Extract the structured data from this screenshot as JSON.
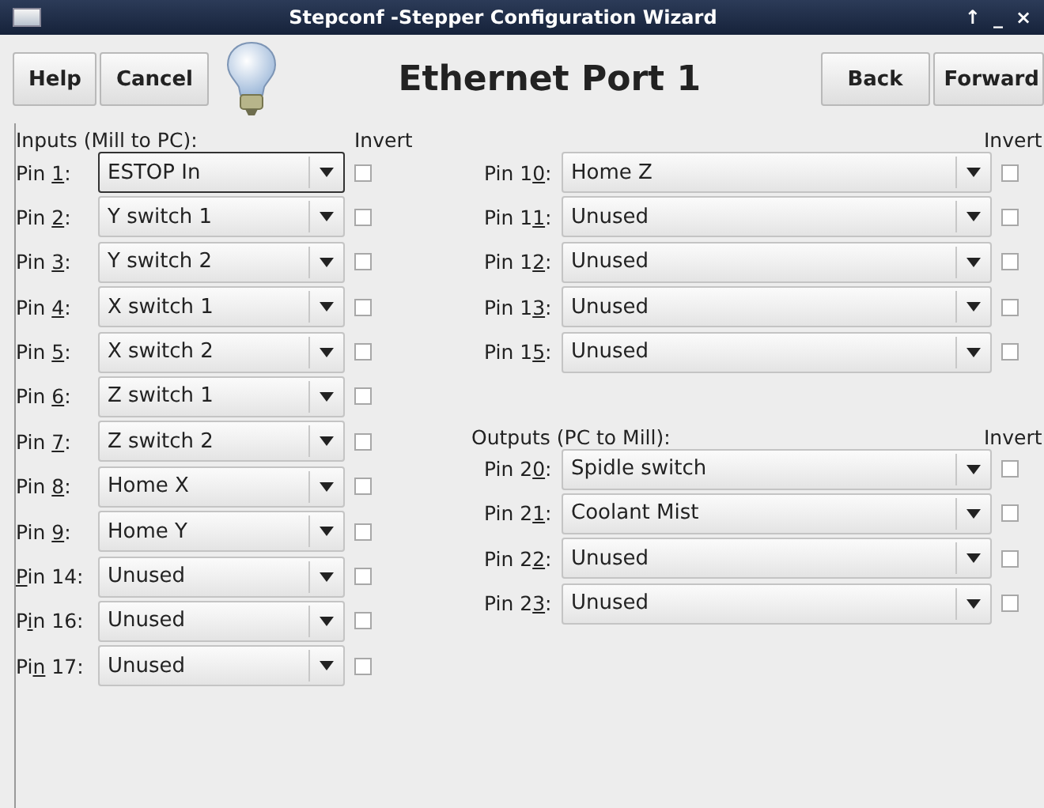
{
  "window": {
    "title": "Stepconf -Stepper Configuration Wizard",
    "controls": [
      "↑",
      "_",
      "×"
    ]
  },
  "toolbar": {
    "left_buttons": [
      "Help",
      "Cancel"
    ],
    "heading": "Ethernet Port 1",
    "right_buttons": [
      "Back",
      "Forward"
    ]
  },
  "inputs": {
    "heading": "Inputs (Mill to PC):",
    "invert_heading": "Invert",
    "pins": [
      {
        "label": {
          "before": "Pin ",
          "key": "1",
          "after": ":"
        },
        "value": "ESTOP In",
        "focused": true,
        "checked": false
      },
      {
        "label": {
          "before": "Pin ",
          "key": "2",
          "after": ":"
        },
        "value": "Y switch 1",
        "focused": false,
        "checked": false
      },
      {
        "label": {
          "before": "Pin ",
          "key": "3",
          "after": ":"
        },
        "value": "Y switch 2",
        "focused": false,
        "checked": false
      },
      {
        "label": {
          "before": "Pin ",
          "key": "4",
          "after": ":"
        },
        "value": "X switch 1",
        "focused": false,
        "checked": false
      },
      {
        "label": {
          "before": "Pin ",
          "key": "5",
          "after": ":"
        },
        "value": "X switch 2",
        "focused": false,
        "checked": false
      },
      {
        "label": {
          "before": "Pin ",
          "key": "6",
          "after": ":"
        },
        "value": "Z switch 1",
        "focused": false,
        "checked": false
      },
      {
        "label": {
          "before": "Pin ",
          "key": "7",
          "after": ":"
        },
        "value": "Z switch 2",
        "focused": false,
        "checked": false
      },
      {
        "label": {
          "before": "Pin ",
          "key": "8",
          "after": ":"
        },
        "value": "Home X",
        "focused": false,
        "checked": false
      },
      {
        "label": {
          "before": "Pin ",
          "key": "9",
          "after": ":"
        },
        "value": "Home Y",
        "focused": false,
        "checked": false
      },
      {
        "label": {
          "key": "P",
          "after": "in 14:"
        },
        "value": "Unused",
        "focused": false,
        "checked": false
      },
      {
        "label": {
          "before": "P",
          "key": "i",
          "after": "n 16:"
        },
        "value": "Unused",
        "focused": false,
        "checked": false
      },
      {
        "label": {
          "before": "Pi",
          "key": "n",
          "after": " 17:"
        },
        "value": "Unused",
        "focused": false,
        "checked": false
      }
    ]
  },
  "more_inputs": {
    "invert_heading": "Invert",
    "pins": [
      {
        "label": {
          "before": "Pin 1",
          "key": "0",
          "after": ":"
        },
        "value": "Home Z",
        "focused": false,
        "checked": false
      },
      {
        "label": {
          "before": "Pin 1",
          "key": "1",
          "after": ":"
        },
        "value": "Unused",
        "focused": false,
        "checked": false
      },
      {
        "label": {
          "before": "Pin 1",
          "key": "2",
          "after": ":"
        },
        "value": "Unused",
        "focused": false,
        "checked": false
      },
      {
        "label": {
          "before": "Pin 1",
          "key": "3",
          "after": ":"
        },
        "value": "Unused",
        "focused": false,
        "checked": false
      },
      {
        "label": {
          "before": "Pin 1",
          "key": "5",
          "after": ":"
        },
        "value": "Unused",
        "focused": false,
        "checked": false
      }
    ]
  },
  "outputs": {
    "heading": "Outputs (PC to Mill):",
    "invert_heading": "Invert",
    "pins": [
      {
        "label": {
          "before": "Pin 2",
          "key": "0",
          "after": ":"
        },
        "value": "Spidle switch",
        "focused": false,
        "checked": false
      },
      {
        "label": {
          "before": "Pin 2",
          "key": "1",
          "after": ":"
        },
        "value": "Coolant Mist",
        "focused": false,
        "checked": false
      },
      {
        "label": {
          "before": "Pin 2",
          "key": "2",
          "after": ":"
        },
        "value": "Unused",
        "focused": false,
        "checked": false
      },
      {
        "label": {
          "before": "Pin 2",
          "key": "3",
          "after": ":"
        },
        "value": "Unused",
        "focused": false,
        "checked": false
      }
    ]
  }
}
